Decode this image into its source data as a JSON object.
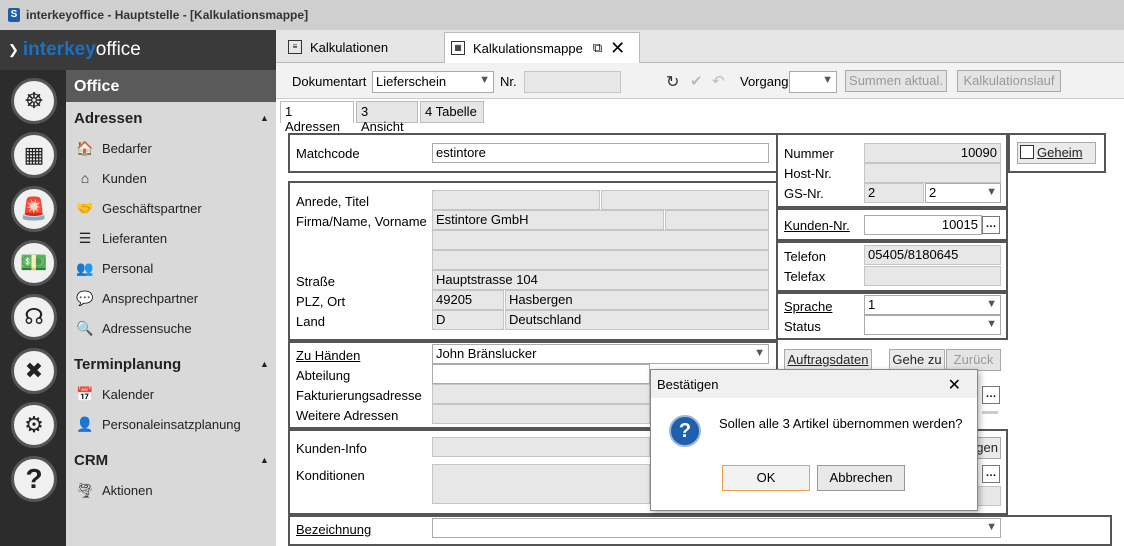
{
  "window": {
    "title": "interkeyoffice - Hauptstelle - [Kalkulationsmappe]"
  },
  "brand": {
    "part1": "interkey",
    "part2": "office"
  },
  "iconbar": [
    {
      "name": "ship-wheel-icon"
    },
    {
      "name": "dashboard-icon"
    },
    {
      "name": "alarm-icon"
    },
    {
      "name": "money-icon"
    },
    {
      "name": "headset-icon"
    },
    {
      "name": "tools-icon"
    },
    {
      "name": "gears-icon"
    },
    {
      "name": "help-icon"
    }
  ],
  "sidebar": {
    "office": "Office",
    "adressen": "Adressen",
    "adressen_items": [
      "Bedarfer",
      "Kunden",
      "Geschäftspartner",
      "Lieferanten",
      "Personal",
      "Ansprechpartner",
      "Adressensuche"
    ],
    "termin": "Terminplanung",
    "termin_items": [
      "Kalender",
      "Personaleinsatzplanung"
    ],
    "crm": "CRM",
    "crm_items": [
      "Aktionen"
    ]
  },
  "tabs": {
    "tab1": "Kalkulationen",
    "tab2": "Kalkulationsmappe"
  },
  "toolbar": {
    "dokumentart_label": "Dokumentart",
    "dokumentart_value": "Lieferschein",
    "nr_label": "Nr.",
    "vorgang_label": "Vorgang",
    "summen": "Summen aktual.",
    "kalkulationslauf": "Kalkulationslauf"
  },
  "subtabs": [
    "1 Adressen",
    "3 Ansicht",
    "4 Tabelle"
  ],
  "form": {
    "matchcode_label": "Matchcode",
    "matchcode": "estintore",
    "anrede_label": "Anrede, Titel",
    "firma_label": "Firma/Name, Vorname",
    "firma": "Estintore GmbH",
    "strasse_label": "Straße",
    "strasse": "Hauptstrasse 104",
    "plz_label": "PLZ, Ort",
    "plz": "49205",
    "ort": "Hasbergen",
    "land_label": "Land",
    "land_code": "D",
    "land": "Deutschland",
    "zuhaenden_label": "Zu Händen",
    "zuhaenden": "John Bränslucker",
    "abteilung_label": "Abteilung",
    "faktur_label": "Fakturierungsadresse",
    "weitere_label": "Weitere Adressen",
    "kundeninfo_label": "Kunden-Info",
    "konditionen_label": "Konditionen",
    "bezeichnung_label": "Bezeichnung",
    "nummer_label": "Nummer",
    "nummer": "10090",
    "host_label": "Host-Nr.",
    "gs_label": "GS-Nr.",
    "gs1": "2",
    "gs2": "2",
    "kunden_label": "Kunden-Nr.",
    "kunden": "10015",
    "telefon_label": "Telefon",
    "telefon": "05405/8180645",
    "telefax_label": "Telefax",
    "sprache_label": "Sprache",
    "sprache": "1",
    "status_label": "Status",
    "geheim": "Geheim",
    "auftragsdaten": "Auftragsdaten",
    "gehezu": "Gehe zu",
    "zurueck": "Zurück",
    "gen_partial": "gen"
  },
  "dialog": {
    "title": "Bestätigen",
    "message": "Sollen alle 3 Artikel übernommen werden?",
    "ok": "OK",
    "cancel": "Abbrechen"
  }
}
